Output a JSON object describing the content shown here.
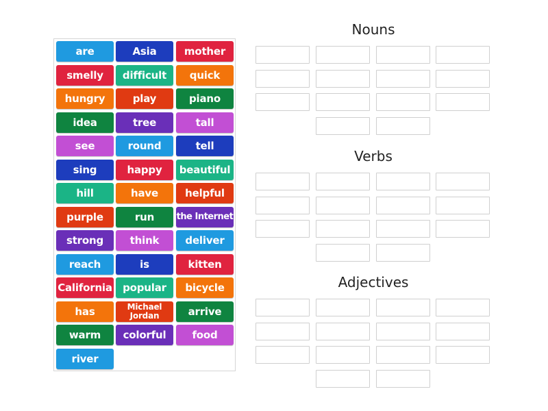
{
  "tiles": [
    {
      "label": "are",
      "color": "#1f9ae0"
    },
    {
      "label": "Asia",
      "color": "#1d3dbd"
    },
    {
      "label": "mother",
      "color": "#e0233f"
    },
    {
      "label": "smelly",
      "color": "#e0233f"
    },
    {
      "label": "difficult",
      "color": "#1bb486"
    },
    {
      "label": "quick",
      "color": "#f3740b"
    },
    {
      "label": "hungry",
      "color": "#f3740b"
    },
    {
      "label": "play",
      "color": "#e03a12"
    },
    {
      "label": "piano",
      "color": "#0f8440"
    },
    {
      "label": "idea",
      "color": "#0f8440"
    },
    {
      "label": "tree",
      "color": "#6a2fb8"
    },
    {
      "label": "tall",
      "color": "#c24fd4"
    },
    {
      "label": "see",
      "color": "#c24fd4"
    },
    {
      "label": "round",
      "color": "#1f9ae0"
    },
    {
      "label": "tell",
      "color": "#1d3dbd"
    },
    {
      "label": "sing",
      "color": "#1d3dbd"
    },
    {
      "label": "happy",
      "color": "#e0233f"
    },
    {
      "label": "beautiful",
      "color": "#1bb486"
    },
    {
      "label": "hill",
      "color": "#1bb486"
    },
    {
      "label": "have",
      "color": "#f3740b"
    },
    {
      "label": "helpful",
      "color": "#e03a12"
    },
    {
      "label": "purple",
      "color": "#e03a12"
    },
    {
      "label": "run",
      "color": "#0f8440"
    },
    {
      "label": "the Internet",
      "color": "#6a2fb8"
    },
    {
      "label": "strong",
      "color": "#6a2fb8"
    },
    {
      "label": "think",
      "color": "#c24fd4"
    },
    {
      "label": "deliver",
      "color": "#1f9ae0"
    },
    {
      "label": "reach",
      "color": "#1f9ae0"
    },
    {
      "label": "is",
      "color": "#1d3dbd"
    },
    {
      "label": "kitten",
      "color": "#e0233f"
    },
    {
      "label": "California",
      "color": "#e0233f"
    },
    {
      "label": "popular",
      "color": "#1bb486"
    },
    {
      "label": "bicycle",
      "color": "#f3740b"
    },
    {
      "label": "has",
      "color": "#f3740b"
    },
    {
      "label": "Michael Jordan",
      "color": "#e03a12"
    },
    {
      "label": "arrive",
      "color": "#0f8440"
    },
    {
      "label": "warm",
      "color": "#0f8440"
    },
    {
      "label": "colorful",
      "color": "#6a2fb8"
    },
    {
      "label": "food",
      "color": "#c24fd4"
    },
    {
      "label": "river",
      "color": "#1f9ae0"
    }
  ],
  "groups": [
    {
      "title": "Nouns",
      "slot_count": 14
    },
    {
      "title": "Verbs",
      "slot_count": 14
    },
    {
      "title": "Adjectives",
      "slot_count": 14
    }
  ]
}
